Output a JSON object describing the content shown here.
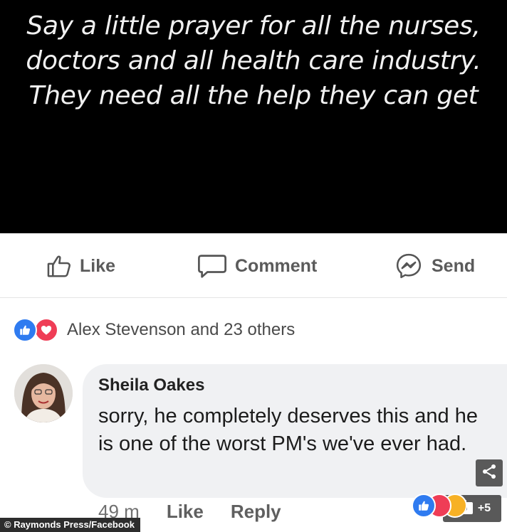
{
  "post": {
    "image_text": "Say a little prayer for all the nurses, doctors and all health care industry. They need all the help they can get"
  },
  "actions": {
    "like_label": "Like",
    "comment_label": "Comment",
    "send_label": "Send"
  },
  "reactions": {
    "summary": "Alex Stevenson and 23 others"
  },
  "comment": {
    "author": "Sheila Oakes",
    "text": "sorry, he completely deserves this and he is one of the worst PM's we've ever had.",
    "time": "49 m",
    "like_label": "Like",
    "reply_label": "Reply"
  },
  "overlay": {
    "credit": "© Raymonds Press/Facebook",
    "photo_count": "+5"
  },
  "colors": {
    "like_blue": "#2f7bf0",
    "love_red": "#ef3d56",
    "haha_yellow": "#f7b125"
  },
  "icons": {
    "like": "thumbs-up-icon",
    "comment": "speech-bubble-icon",
    "send": "messenger-icon",
    "share": "share-icon",
    "camera": "camera-icon"
  }
}
